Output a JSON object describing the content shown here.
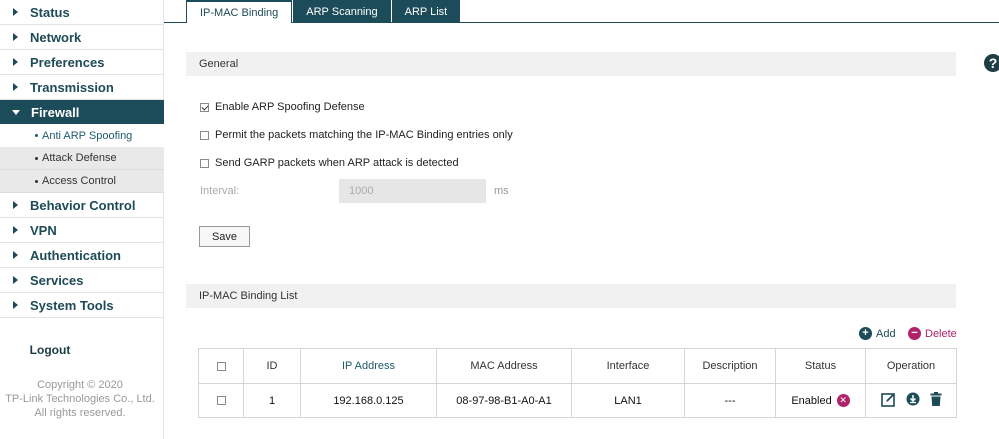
{
  "sidebar": {
    "items": [
      {
        "label": "Status"
      },
      {
        "label": "Network"
      },
      {
        "label": "Preferences"
      },
      {
        "label": "Transmission"
      },
      {
        "label": "Firewall"
      },
      {
        "label": "Behavior Control"
      },
      {
        "label": "VPN"
      },
      {
        "label": "Authentication"
      },
      {
        "label": "Services"
      },
      {
        "label": "System Tools"
      }
    ],
    "firewall_sub": [
      {
        "label": "Anti ARP Spoofing"
      },
      {
        "label": "Attack Defense"
      },
      {
        "label": "Access Control"
      }
    ],
    "logout": "Logout",
    "copyright_line1": "Copyright © 2020",
    "copyright_line2": "TP-Link Technologies Co., Ltd.",
    "copyright_line3": "All rights reserved."
  },
  "tabs": [
    {
      "label": "IP-MAC Binding"
    },
    {
      "label": "ARP Scanning"
    },
    {
      "label": "ARP List"
    }
  ],
  "help_icon": "?",
  "general": {
    "title": "General",
    "options": [
      {
        "label": "Enable ARP Spoofing Defense",
        "checked": true
      },
      {
        "label": "Permit the packets matching the IP-MAC Binding entries only",
        "checked": false
      },
      {
        "label": "Send GARP packets when ARP attack is detected",
        "checked": false
      }
    ],
    "interval_label": "Interval:",
    "interval_value": "1000",
    "interval_unit": "ms",
    "save_label": "Save"
  },
  "list": {
    "title": "IP-MAC Binding List",
    "add_label": "Add",
    "delete_label": "Delete",
    "columns": [
      "ID",
      "IP Address",
      "MAC Address",
      "Interface",
      "Description",
      "Status",
      "Operation"
    ],
    "rows": [
      {
        "id": "1",
        "ip": "192.168.0.125",
        "mac": "08-97-98-B1-A0-A1",
        "interface": "LAN1",
        "description": "---",
        "status": "Enabled"
      }
    ]
  },
  "colors": {
    "accent": "#1c4c59",
    "delete": "#b0226a"
  }
}
